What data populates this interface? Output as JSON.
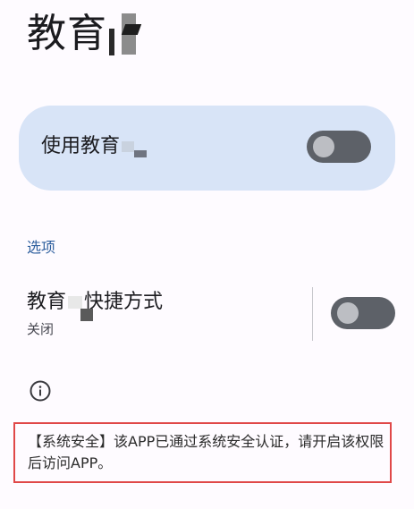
{
  "header": {
    "title": "教育"
  },
  "main_toggle": {
    "label": "使用教育",
    "state": "off"
  },
  "options_section": {
    "header": "选项",
    "shortcut": {
      "title_prefix": "教育",
      "title_suffix": "快捷方式",
      "subtitle": "关闭",
      "state": "off"
    }
  },
  "info": {
    "icon": "info-icon"
  },
  "notice": {
    "text": "【系统安全】该APP已通过系统安全认证，请开启该权限后访问APP。",
    "border_color": "#e04848"
  },
  "colors": {
    "card_background": "#d8e4f7",
    "switch_track": "#5d6168",
    "switch_thumb": "#bcbec3",
    "section_header": "#2e5f9e"
  }
}
